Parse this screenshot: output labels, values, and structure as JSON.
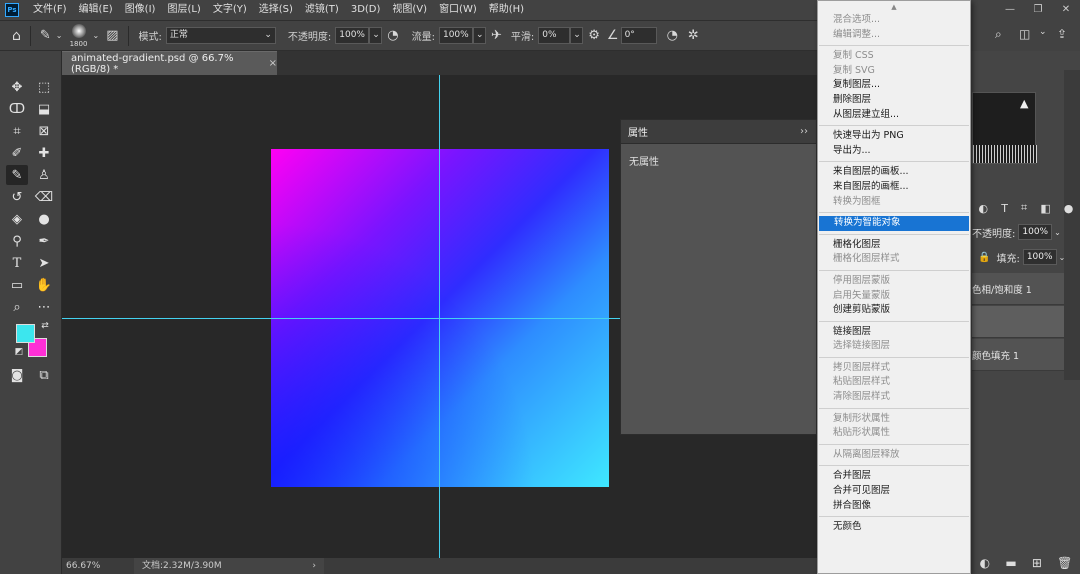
{
  "app": {
    "logo": "Ps"
  },
  "menubar": {
    "items": [
      "文件(F)",
      "编辑(E)",
      "图像(I)",
      "图层(L)",
      "文字(Y)",
      "选择(S)",
      "滤镜(T)",
      "3D(D)",
      "视图(V)",
      "窗口(W)",
      "帮助(H)"
    ]
  },
  "options": {
    "brush_size": "1800",
    "mode_label": "模式:",
    "mode_value": "正常",
    "opacity_label": "不透明度:",
    "opacity_value": "100%",
    "flow_label": "流量:",
    "flow_value": "100%",
    "smooth_label": "平滑:",
    "smooth_value": "0%",
    "angle_value": "0°"
  },
  "document": {
    "tab_title": "animated-gradient.psd @ 66.7%(RGB/8) *",
    "close_glyph": "×",
    "zoom": "66.67%",
    "doc_size": "文档:2.32M/3.90M",
    "status_arrow": "›"
  },
  "colors": {
    "foreground": "#3ce6ee",
    "background": "#ff2fd6",
    "guide": "#44d2ef",
    "menu_highlight": "#1874d3"
  },
  "tools": [
    "move-icon",
    "marquee-icon",
    "lasso-icon",
    "object-select-icon",
    "crop-icon",
    "frame-icon",
    "eyedropper-icon",
    "healing-brush-icon",
    "brush-icon",
    "stamp-icon",
    "history-brush-icon",
    "eraser-icon",
    "paint-bucket-icon",
    "blur-icon",
    "dodge-icon",
    "pen-icon",
    "type-icon",
    "path-select-icon",
    "rectangle-icon",
    "hand-icon",
    "zoom-icon",
    "more-tools-icon",
    "quick-mask-icon",
    "screen-mode-icon"
  ],
  "properties_panel": {
    "tab": "属性",
    "collapse_glyph": "››",
    "body": "无属性"
  },
  "layers_panel": {
    "opacity_label": "不透明度:",
    "opacity_value": "100%",
    "fill_label": "填充:",
    "fill_value": "100%",
    "layers": [
      "色相/饱和度 1",
      "",
      "颜色填充 1"
    ]
  },
  "context_menu": {
    "groups": [
      [
        {
          "label": "混合选项...",
          "disabled": true
        },
        {
          "label": "编辑调整...",
          "disabled": true
        }
      ],
      [
        {
          "label": "复制 CSS",
          "disabled": true
        },
        {
          "label": "复制 SVG",
          "disabled": true
        },
        {
          "label": "复制图层...",
          "disabled": false
        },
        {
          "label": "删除图层",
          "disabled": false
        },
        {
          "label": "从图层建立组...",
          "disabled": false
        }
      ],
      [
        {
          "label": "快速导出为 PNG",
          "disabled": false
        },
        {
          "label": "导出为...",
          "disabled": false
        }
      ],
      [
        {
          "label": "来自图层的画板...",
          "disabled": false
        },
        {
          "label": "来自图层的画框...",
          "disabled": false
        },
        {
          "label": "转换为图框",
          "disabled": true
        }
      ],
      [
        {
          "label": "转换为智能对象",
          "disabled": false,
          "highlighted": true
        }
      ],
      [
        {
          "label": "栅格化图层",
          "disabled": false
        },
        {
          "label": "栅格化图层样式",
          "disabled": true
        }
      ],
      [
        {
          "label": "停用图层蒙版",
          "disabled": true
        },
        {
          "label": "启用矢量蒙版",
          "disabled": true
        },
        {
          "label": "创建剪贴蒙版",
          "disabled": false
        }
      ],
      [
        {
          "label": "链接图层",
          "disabled": false
        },
        {
          "label": "选择链接图层",
          "disabled": true
        }
      ],
      [
        {
          "label": "拷贝图层样式",
          "disabled": true
        },
        {
          "label": "粘贴图层样式",
          "disabled": true
        },
        {
          "label": "清除图层样式",
          "disabled": true
        }
      ],
      [
        {
          "label": "复制形状属性",
          "disabled": true
        },
        {
          "label": "粘贴形状属性",
          "disabled": true
        }
      ],
      [
        {
          "label": "从隔离图层释放",
          "disabled": true
        }
      ],
      [
        {
          "label": "合并图层",
          "disabled": false
        },
        {
          "label": "合并可见图层",
          "disabled": false
        },
        {
          "label": "拼合图像",
          "disabled": false
        }
      ],
      [
        {
          "label": "无颜色",
          "disabled": false
        }
      ]
    ]
  }
}
